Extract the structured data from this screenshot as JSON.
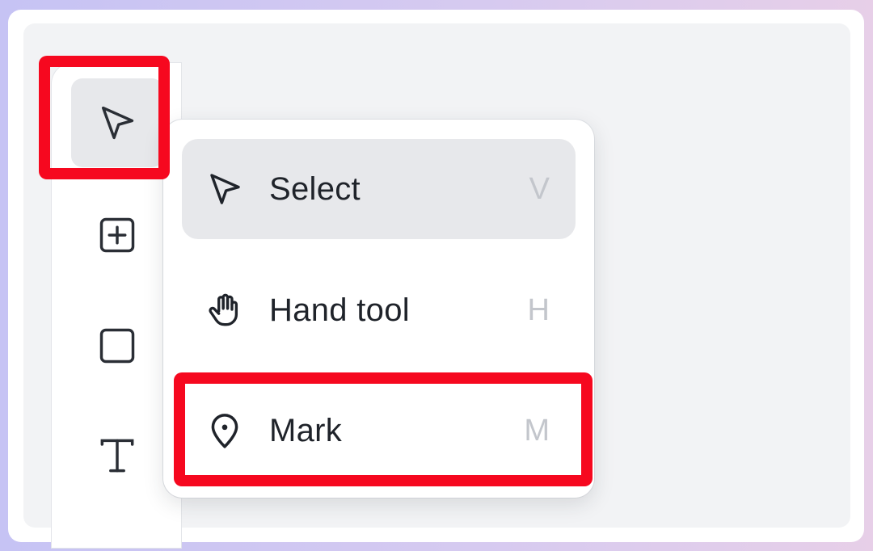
{
  "toolbar": {
    "tools": [
      {
        "name": "select",
        "icon": "cursor-icon",
        "active": true
      },
      {
        "name": "add",
        "icon": "plus-square-icon",
        "active": false
      },
      {
        "name": "rectangle",
        "icon": "square-icon",
        "active": false
      },
      {
        "name": "text",
        "icon": "text-icon",
        "active": false
      }
    ]
  },
  "menu": {
    "items": [
      {
        "label": "Select",
        "shortcut": "V",
        "icon": "cursor-icon",
        "selected": true
      },
      {
        "label": "Hand tool",
        "shortcut": "H",
        "icon": "hand-icon",
        "selected": false
      },
      {
        "label": "Mark",
        "shortcut": "M",
        "icon": "location-pin-icon",
        "selected": false
      }
    ]
  },
  "colors": {
    "highlight": "#f6081f",
    "canvas_bg": "#f2f3f5",
    "selected_bg": "#e7e8eb",
    "text": "#1f232a",
    "shortcut_text": "#c3c6cc"
  }
}
